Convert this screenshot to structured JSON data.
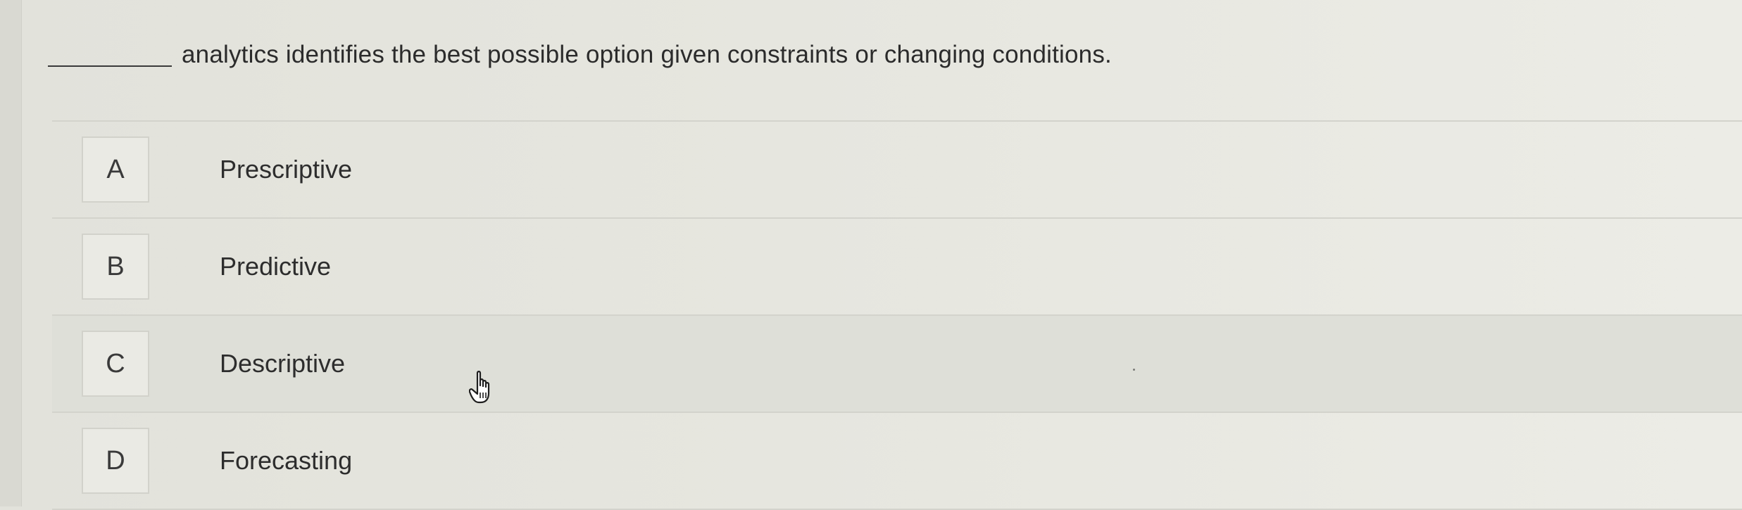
{
  "question": {
    "text": "analytics identifies the best possible option given constraints or changing conditions."
  },
  "options": [
    {
      "letter": "A",
      "label": "Prescriptive"
    },
    {
      "letter": "B",
      "label": "Predictive"
    },
    {
      "letter": "C",
      "label": "Descriptive"
    },
    {
      "letter": "D",
      "label": "Forecasting"
    }
  ],
  "hovered_option": "C",
  "icons": {
    "cursor": "hand-pointer-icon"
  }
}
